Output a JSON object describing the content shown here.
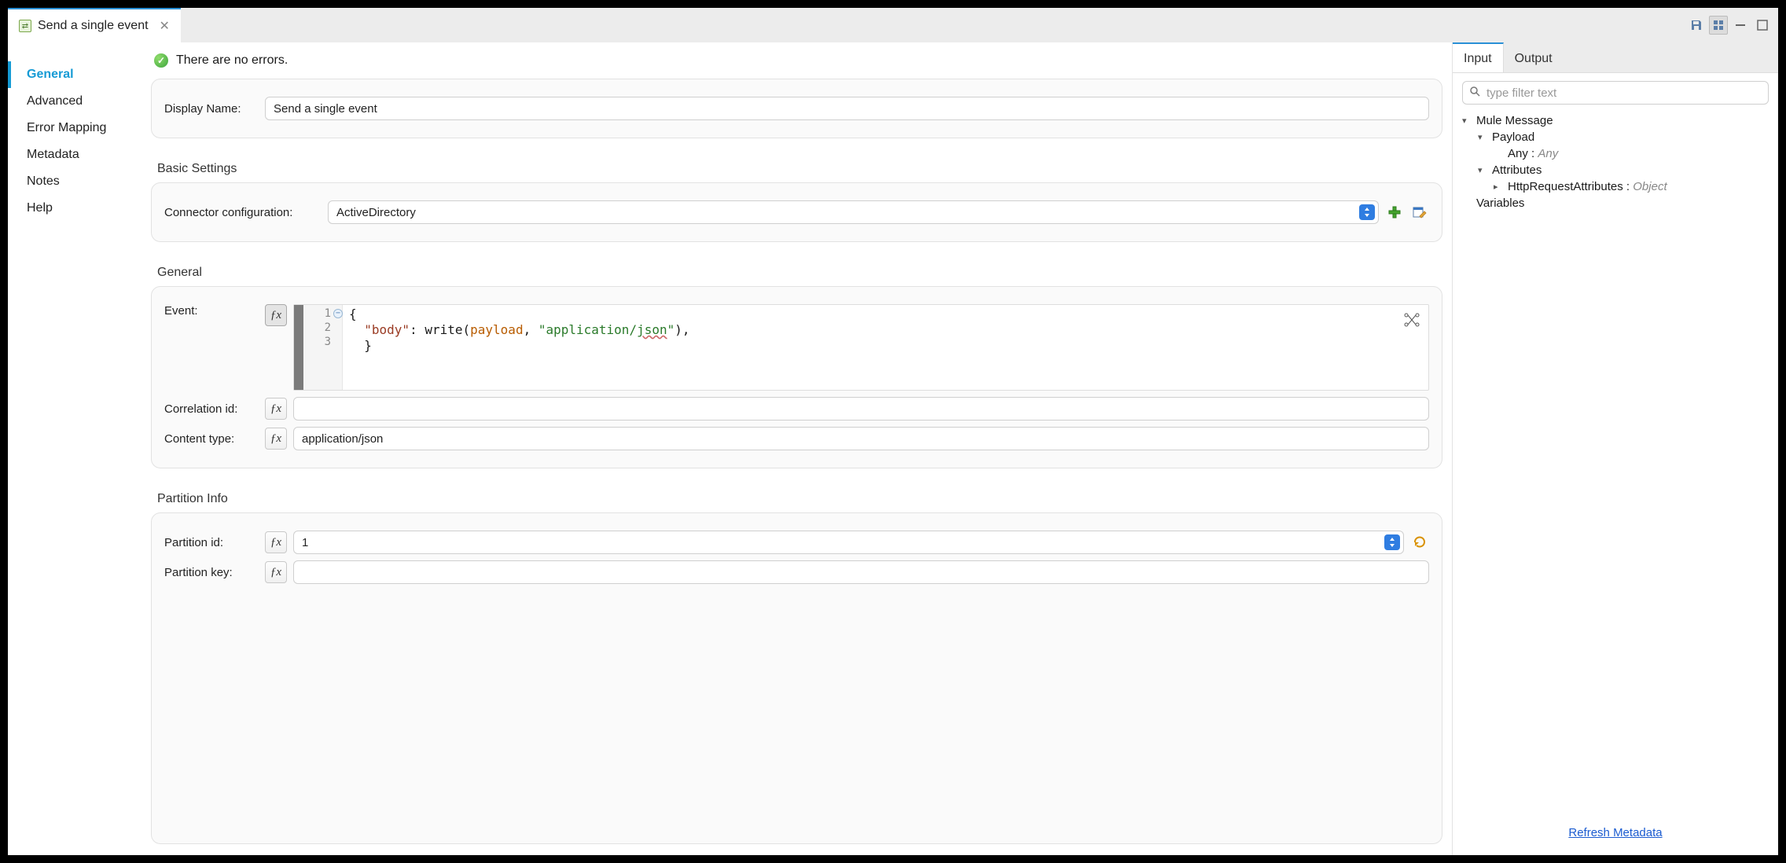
{
  "tab": {
    "title": "Send a single event"
  },
  "sidebar": {
    "items": [
      "General",
      "Advanced",
      "Error Mapping",
      "Metadata",
      "Notes",
      "Help"
    ],
    "activeIndex": 0
  },
  "status": {
    "text": "There are no errors."
  },
  "general": {
    "display_name_label": "Display Name:",
    "display_name_value": "Send a single event",
    "basic_title": "Basic Settings",
    "connector_label": "Connector configuration:",
    "connector_value": "ActiveDirectory",
    "section_title": "General",
    "event_label": "Event:",
    "code": {
      "line_numbers": [
        "1",
        "2",
        "3"
      ],
      "tokens": {
        "body_key": "\"body\"",
        "write_fn": "write",
        "payload": "payload",
        "mime": "\"application/",
        "json_part": "json",
        "mime_close": "\""
      }
    },
    "correlation_label": "Correlation id:",
    "correlation_value": "",
    "content_type_label": "Content type:",
    "content_type_value": "application/json",
    "partition_title": "Partition Info",
    "partition_id_label": "Partition id:",
    "partition_id_value": "1",
    "partition_key_label": "Partition key:",
    "partition_key_value": ""
  },
  "inspector": {
    "tabs": [
      "Input",
      "Output"
    ],
    "activeTabIndex": 0,
    "filter_placeholder": "type filter text",
    "tree": {
      "root": "Mule Message",
      "payload_label": "Payload",
      "payload_child_name": "Any",
      "payload_child_type": "Any",
      "attributes_label": "Attributes",
      "attributes_child_name": "HttpRequestAttributes",
      "attributes_child_type": "Object",
      "variables_label": "Variables"
    },
    "refresh_label": "Refresh Metadata"
  }
}
